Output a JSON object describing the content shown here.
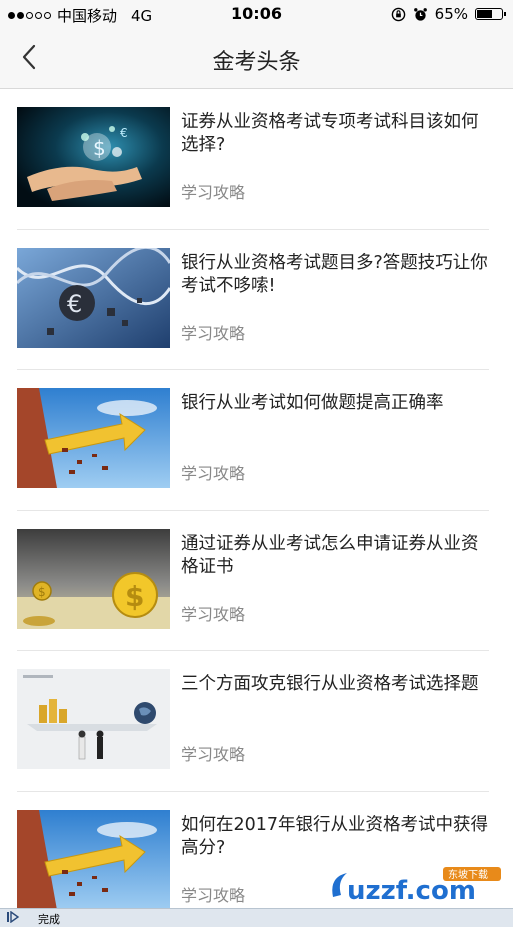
{
  "status_bar": {
    "carrier": "中国移动",
    "network": "4G",
    "time": "10:06",
    "battery_percent": "65%",
    "battery_level": 0.65,
    "signal_bars_filled": 2,
    "signal_bars_total": 5
  },
  "nav": {
    "title": "金考头条",
    "back_icon": "chevron-left-icon"
  },
  "articles": [
    {
      "title": "证券从业资格考试专项考试科目该如何选择?",
      "category": "学习攻略",
      "thumbnail": "hands-money-glow"
    },
    {
      "title": "银行从业资格考试题目多?答题技巧让你考试不哆嗦!",
      "category": "学习攻略",
      "thumbnail": "dna-euro"
    },
    {
      "title": "银行从业考试如何做题提高正确率",
      "category": "学习攻略",
      "thumbnail": "arrow-wall"
    },
    {
      "title": "通过证券从业考试怎么申请证券从业资格证书",
      "category": "学习攻略",
      "thumbnail": "dollar-coins-desert"
    },
    {
      "title": "三个方面攻克银行从业资格考试选择题",
      "category": "学习攻略",
      "thumbnail": "balance-coins-globe"
    },
    {
      "title": "如何在2017年银行从业资格考试中获得高分?",
      "category": "学习攻略",
      "thumbnail": "arrow-wall"
    }
  ],
  "footer": {
    "status_text": "完成"
  },
  "watermark": {
    "text": "uzzf.com",
    "badge": "东坡下载"
  },
  "colors": {
    "title_text": "#222222",
    "category_text": "#888888",
    "bar_background": "#f7f7f7"
  }
}
